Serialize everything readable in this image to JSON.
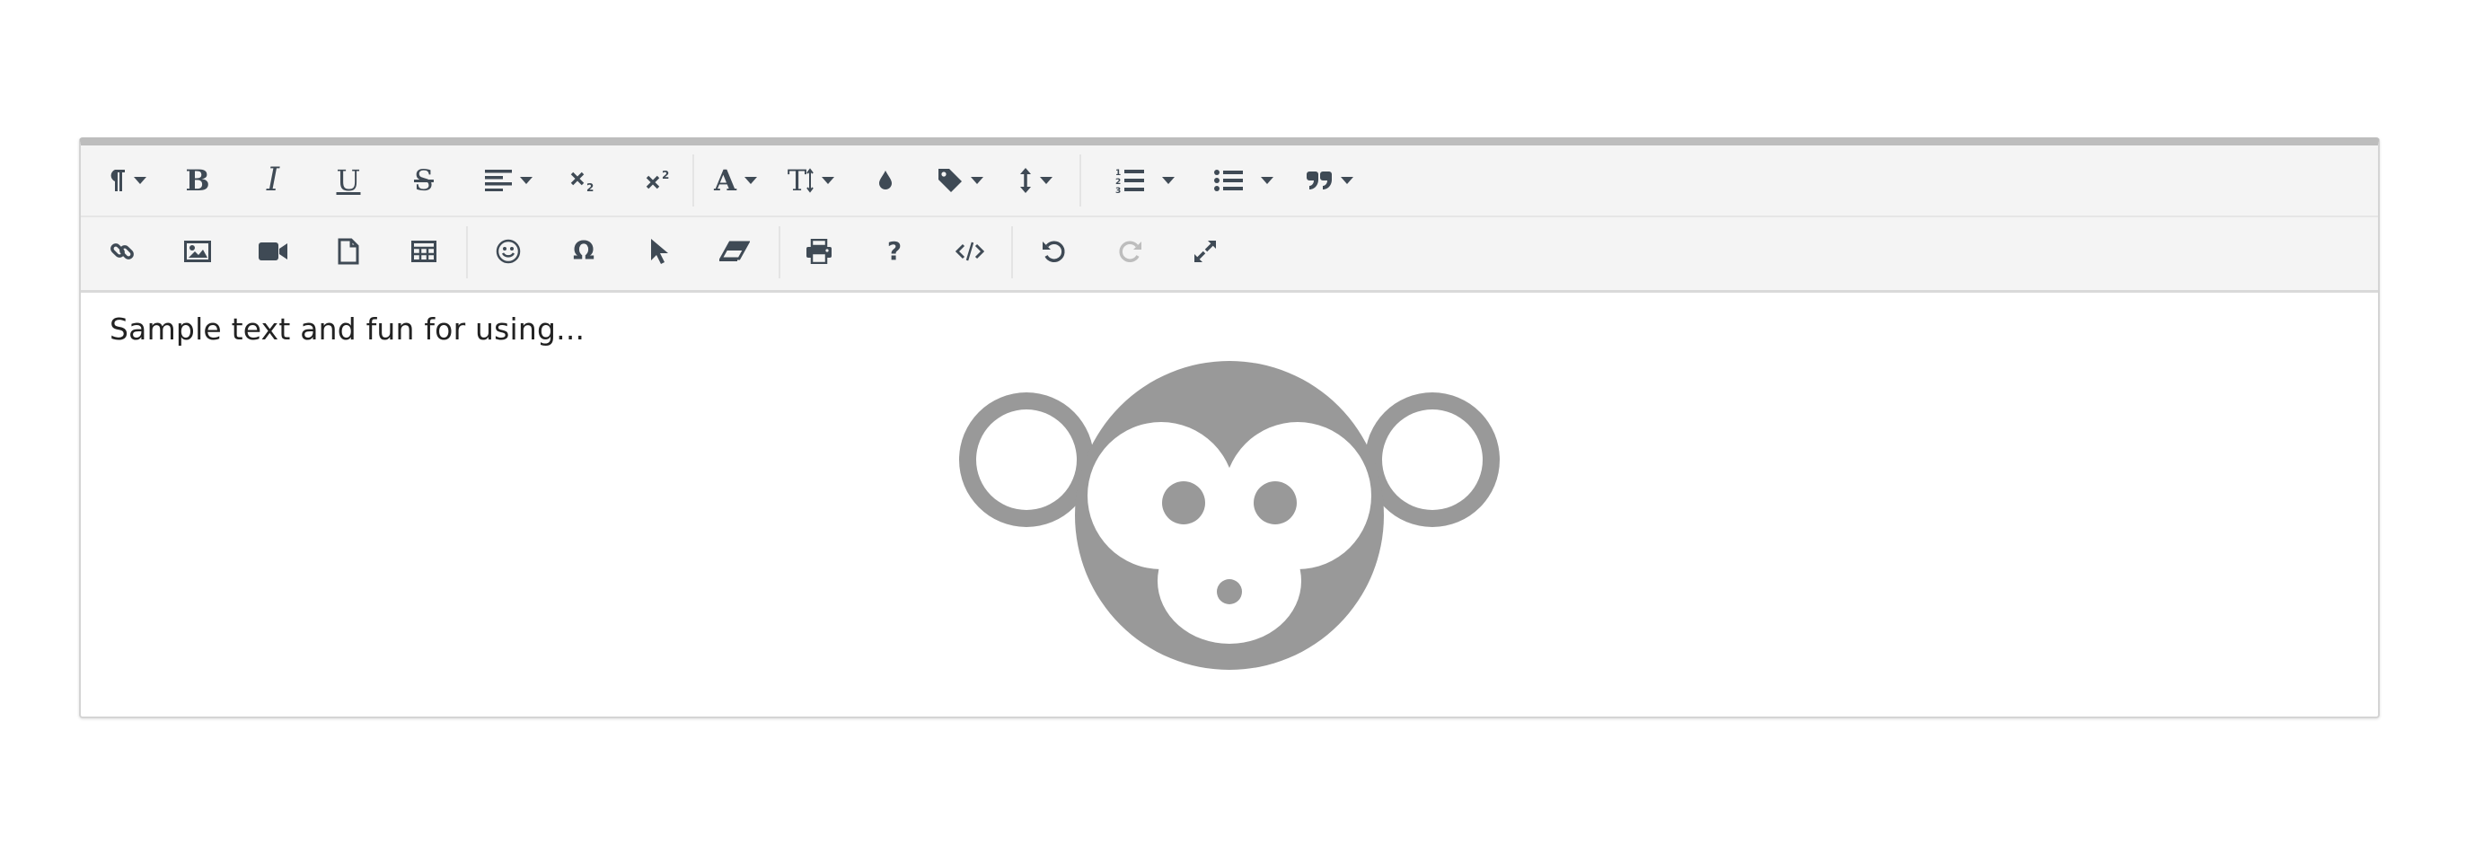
{
  "editor": {
    "content_text": "Sample text and fun for using...",
    "toolbar": {
      "row1": [
        {
          "name": "paragraph-format",
          "icon": "paragraph-icon",
          "dropdown": true
        },
        {
          "name": "bold",
          "icon": "bold-icon",
          "glyph": "B"
        },
        {
          "name": "italic",
          "icon": "italic-icon",
          "glyph": "I"
        },
        {
          "name": "underline",
          "icon": "underline-icon",
          "glyph": "U"
        },
        {
          "name": "strikethrough",
          "icon": "strikethrough-icon",
          "glyph": "S"
        },
        {
          "name": "align",
          "icon": "align-left-icon",
          "dropdown": true
        },
        {
          "name": "subscript",
          "icon": "subscript-icon"
        },
        {
          "name": "superscript",
          "icon": "superscript-icon"
        },
        {
          "name": "font-family",
          "icon": "font-icon",
          "glyph": "A",
          "dropdown": true
        },
        {
          "name": "font-size",
          "icon": "text-height-icon",
          "glyph": "T",
          "dropdown": true
        },
        {
          "name": "text-color",
          "icon": "droplet-icon"
        },
        {
          "name": "paragraph-style",
          "icon": "tag-icon",
          "dropdown": true
        },
        {
          "name": "line-height",
          "icon": "line-height-icon",
          "dropdown": true
        },
        {
          "name": "ordered-list",
          "icon": "ordered-list-icon",
          "dropdown": true
        },
        {
          "name": "unordered-list",
          "icon": "unordered-list-icon",
          "dropdown": true
        },
        {
          "name": "quote",
          "icon": "quote-icon",
          "dropdown": true
        }
      ],
      "row2": [
        {
          "name": "insert-link",
          "icon": "link-icon"
        },
        {
          "name": "insert-image",
          "icon": "image-icon"
        },
        {
          "name": "insert-video",
          "icon": "video-icon"
        },
        {
          "name": "insert-file",
          "icon": "file-icon"
        },
        {
          "name": "insert-table",
          "icon": "table-icon"
        },
        {
          "name": "emoticons",
          "icon": "smile-icon"
        },
        {
          "name": "special-characters",
          "icon": "omega-icon",
          "glyph": "Ω"
        },
        {
          "name": "select-all",
          "icon": "cursor-icon"
        },
        {
          "name": "clear-formatting",
          "icon": "eraser-icon"
        },
        {
          "name": "print",
          "icon": "print-icon"
        },
        {
          "name": "help",
          "icon": "question-icon",
          "glyph": "?"
        },
        {
          "name": "code-view",
          "icon": "code-icon"
        },
        {
          "name": "undo",
          "icon": "undo-icon"
        },
        {
          "name": "redo",
          "icon": "redo-icon",
          "disabled": true
        },
        {
          "name": "fullscreen",
          "icon": "expand-icon"
        }
      ]
    },
    "colors": {
      "toolbar_bg": "#f4f4f4",
      "icon": "#3f4a55",
      "icon_disabled": "#bdbdbd",
      "monkey": "#999999",
      "top_border": "#bdbdbd"
    },
    "image": {
      "icon": "monkey-icon"
    }
  }
}
